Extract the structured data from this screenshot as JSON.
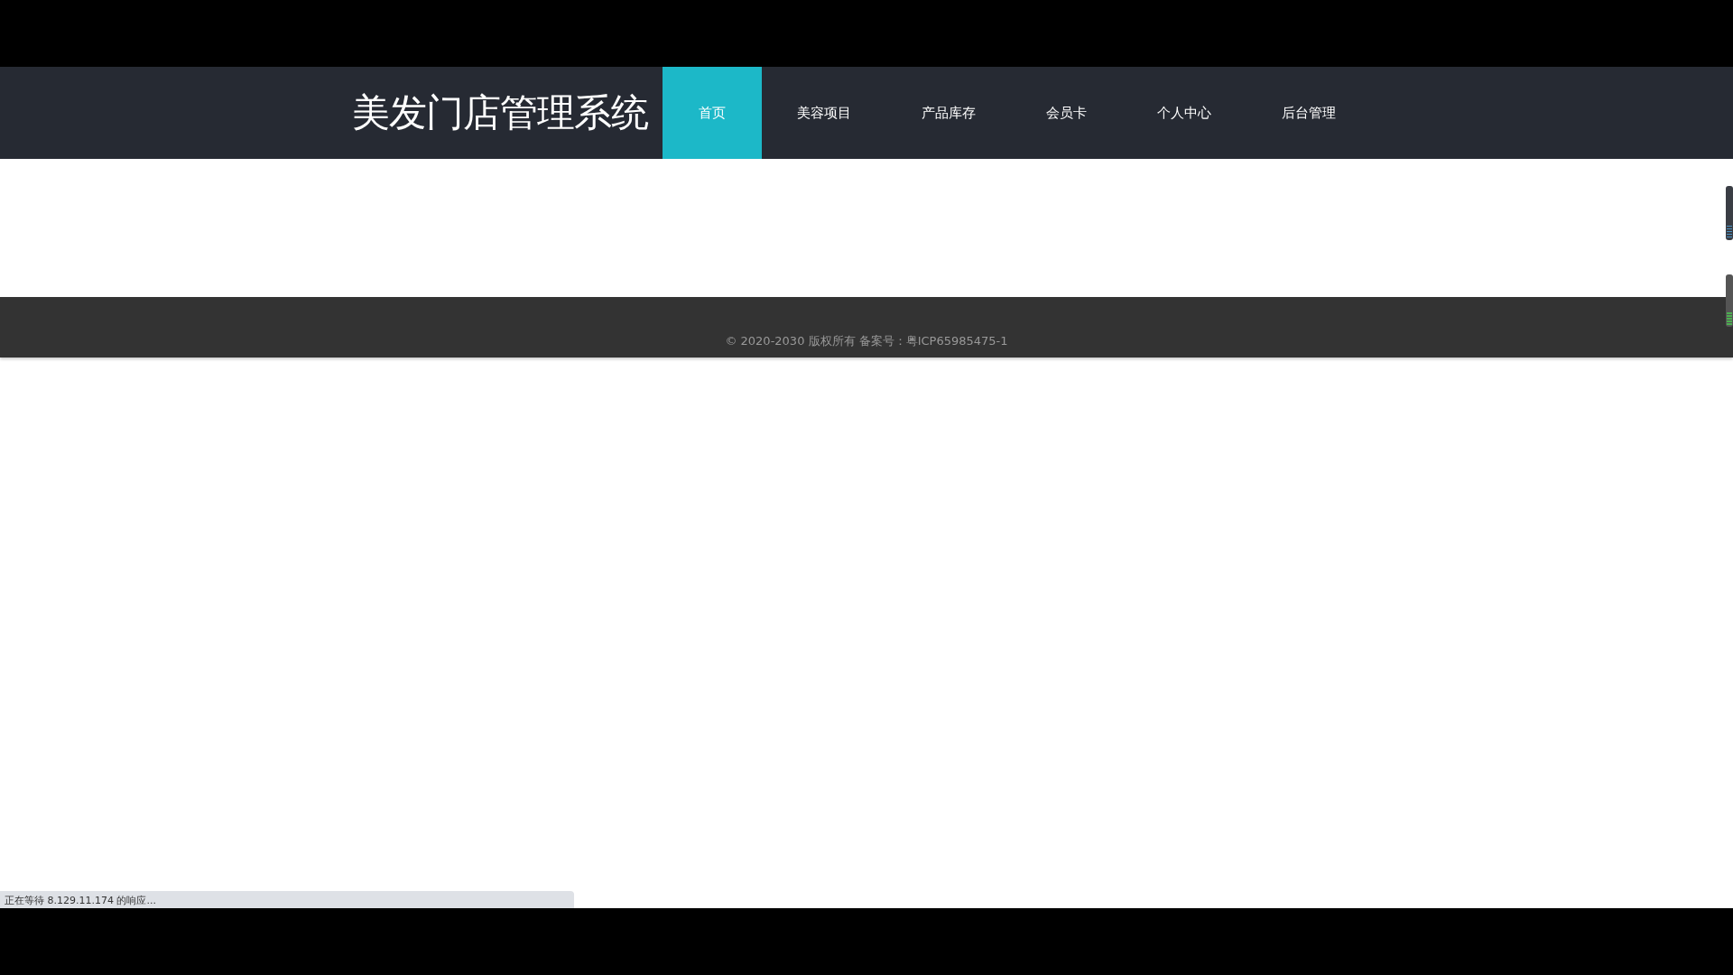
{
  "header": {
    "title": "美发门店管理系统"
  },
  "nav": [
    {
      "label": "首页",
      "selected": true
    },
    {
      "label": "美容项目",
      "selected": false
    },
    {
      "label": "产品库存",
      "selected": false
    },
    {
      "label": "会员卡",
      "selected": false
    },
    {
      "label": "个人中心",
      "selected": false
    },
    {
      "label": "后台管理",
      "selected": false
    }
  ],
  "footer": {
    "text": "© 2020-2030 版权所有 备案号：粤ICP65985475-1"
  },
  "status_bar": {
    "text": "正在等待 8.129.11.174 的响应..."
  }
}
